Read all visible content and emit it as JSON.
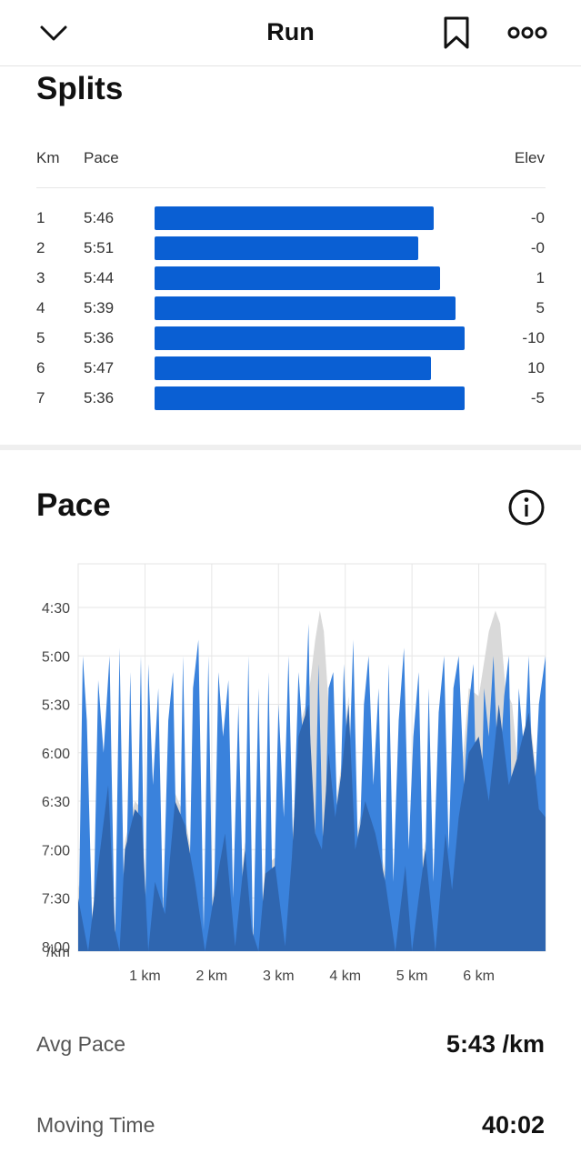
{
  "header": {
    "title": "Run"
  },
  "splits": {
    "heading": "Splits",
    "col_km": "Km",
    "col_pace": "Pace",
    "col_elev": "Elev",
    "rows": [
      {
        "km": "1",
        "pace": "5:46",
        "elev": "-0"
      },
      {
        "km": "2",
        "pace": "5:51",
        "elev": "-0"
      },
      {
        "km": "3",
        "pace": "5:44",
        "elev": "1"
      },
      {
        "km": "4",
        "pace": "5:39",
        "elev": "5"
      },
      {
        "km": "5",
        "pace": "5:36",
        "elev": "-10"
      },
      {
        "km": "6",
        "pace": "5:47",
        "elev": "10"
      },
      {
        "km": "7",
        "pace": "5:36",
        "elev": "-5"
      }
    ],
    "bar_color": "#0a5fd3"
  },
  "pace": {
    "heading": "Pace"
  },
  "chart_data": {
    "type": "area",
    "y_tick_labels": [
      "4:30",
      "5:00",
      "5:30",
      "6:00",
      "6:30",
      "7:00",
      "7:30",
      "8:00"
    ],
    "y_unit_label": "/km",
    "x_tick_labels": [
      "1 km",
      "2 km",
      "3 km",
      "4 km",
      "5 km",
      "6 km"
    ],
    "x_ticks": [
      1,
      2,
      3,
      4,
      5,
      6
    ],
    "xlim": [
      0,
      7
    ],
    "ylim_seconds_per_km": [
      270,
      510
    ],
    "grid": true,
    "series": [
      {
        "color": "#3a82dc",
        "x": [
          0,
          0.07,
          0.13,
          0.22,
          0.3,
          0.38,
          0.47,
          0.55,
          0.62,
          0.7,
          0.78,
          0.86,
          0.94,
          1.0,
          1.05,
          1.12,
          1.2,
          1.27,
          1.35,
          1.42,
          1.5,
          1.57,
          1.65,
          1.72,
          1.8,
          1.88,
          1.95,
          2.02,
          2.1,
          2.17,
          2.25,
          2.32,
          2.4,
          2.48,
          2.55,
          2.62,
          2.7,
          2.78,
          2.85,
          2.92,
          3.0,
          3.08,
          3.15,
          3.22,
          3.3,
          3.38,
          3.45,
          3.52,
          3.6,
          3.68,
          3.75,
          3.82,
          3.9,
          3.98,
          4.05,
          4.12,
          4.2,
          4.28,
          4.35,
          4.42,
          4.5,
          4.58,
          4.65,
          4.72,
          4.8,
          4.88,
          4.95,
          5.02,
          5.1,
          5.18,
          5.25,
          5.32,
          5.4,
          5.48,
          5.55,
          5.62,
          5.7,
          5.78,
          5.85,
          5.92,
          6.0,
          6.08,
          6.15,
          6.22,
          6.3,
          6.38,
          6.45,
          6.52,
          6.6,
          6.68,
          6.75,
          6.82,
          6.9,
          7.0
        ],
        "pace_seconds_per_km": [
          510,
          300,
          340,
          510,
          315,
          360,
          300,
          500,
          295,
          490,
          310,
          500,
          300,
          480,
          305,
          380,
          320,
          460,
          340,
          310,
          490,
          300,
          480,
          320,
          290,
          470,
          300,
          490,
          310,
          350,
          315,
          450,
          330,
          470,
          300,
          490,
          320,
          500,
          310,
          470,
          330,
          400,
          300,
          420,
          310,
          360,
          280,
          470,
          305,
          440,
          320,
          310,
          430,
          305,
          380,
          290,
          440,
          330,
          300,
          380,
          320,
          470,
          305,
          440,
          340,
          295,
          420,
          350,
          310,
          470,
          320,
          440,
          335,
          300,
          420,
          320,
          300,
          380,
          330,
          305,
          460,
          320,
          350,
          300,
          380,
          325,
          300,
          440,
          320,
          360,
          300,
          400,
          330,
          300
        ]
      },
      {
        "color": "#2f66b0",
        "x": [
          0,
          0.15,
          0.3,
          0.45,
          0.55,
          0.62,
          0.7,
          0.85,
          0.95,
          1.05,
          1.15,
          1.3,
          1.45,
          1.6,
          1.75,
          1.9,
          2.05,
          2.2,
          2.35,
          2.5,
          2.6,
          2.7,
          2.8,
          2.95,
          3.1,
          3.2,
          3.3,
          3.45,
          3.55,
          3.65,
          3.75,
          3.85,
          3.95,
          4.05,
          4.15,
          4.3,
          4.45,
          4.6,
          4.75,
          4.9,
          5.0,
          5.1,
          5.2,
          5.35,
          5.5,
          5.6,
          5.7,
          5.85,
          6.0,
          6.15,
          6.3,
          6.45,
          6.6,
          6.75,
          6.9,
          7.0
        ],
        "pace_seconds_per_km": [
          450,
          510,
          430,
          380,
          470,
          510,
          420,
          395,
          400,
          490,
          440,
          460,
          390,
          405,
          440,
          490,
          445,
          410,
          480,
          420,
          470,
          500,
          435,
          430,
          480,
          425,
          350,
          330,
          410,
          420,
          360,
          400,
          370,
          330,
          420,
          390,
          410,
          440,
          500,
          430,
          510,
          450,
          420,
          490,
          410,
          445,
          400,
          360,
          350,
          390,
          330,
          380,
          360,
          335,
          395,
          400
        ]
      },
      {
        "color": "#d9d9d9",
        "x": [
          0,
          0.15,
          0.3,
          0.45,
          0.55,
          0.62,
          0.7,
          0.85,
          0.95,
          1.05,
          1.15,
          1.3,
          1.45,
          1.6,
          1.75,
          1.9,
          2.05,
          2.2,
          2.35,
          2.5,
          2.6,
          2.7,
          2.8,
          2.95,
          3.1,
          3.2,
          3.3,
          3.45,
          3.55,
          3.62,
          3.68,
          3.75,
          3.85,
          3.95,
          4.05,
          4.15,
          4.3,
          4.45,
          4.6,
          4.75,
          4.9,
          5.0,
          5.1,
          5.2,
          5.35,
          5.5,
          5.6,
          5.7,
          5.85,
          6.0,
          6.15,
          6.25,
          6.32,
          6.4,
          6.5,
          6.6,
          6.75,
          6.9,
          7.0
        ],
        "pace_seconds_per_km": [
          440,
          500,
          425,
          375,
          465,
          500,
          415,
          390,
          395,
          485,
          430,
          455,
          385,
          400,
          435,
          485,
          440,
          405,
          475,
          415,
          465,
          495,
          430,
          425,
          475,
          420,
          345,
          325,
          290,
          272,
          285,
          330,
          395,
          365,
          325,
          415,
          385,
          405,
          435,
          495,
          425,
          505,
          445,
          415,
          485,
          405,
          440,
          395,
          320,
          325,
          285,
          272,
          280,
          320,
          330,
          375,
          330,
          390,
          395
        ]
      }
    ]
  },
  "stats": [
    {
      "label": "Avg Pace",
      "value": "5:43 /km"
    },
    {
      "label": "Moving Time",
      "value": "40:02"
    }
  ]
}
